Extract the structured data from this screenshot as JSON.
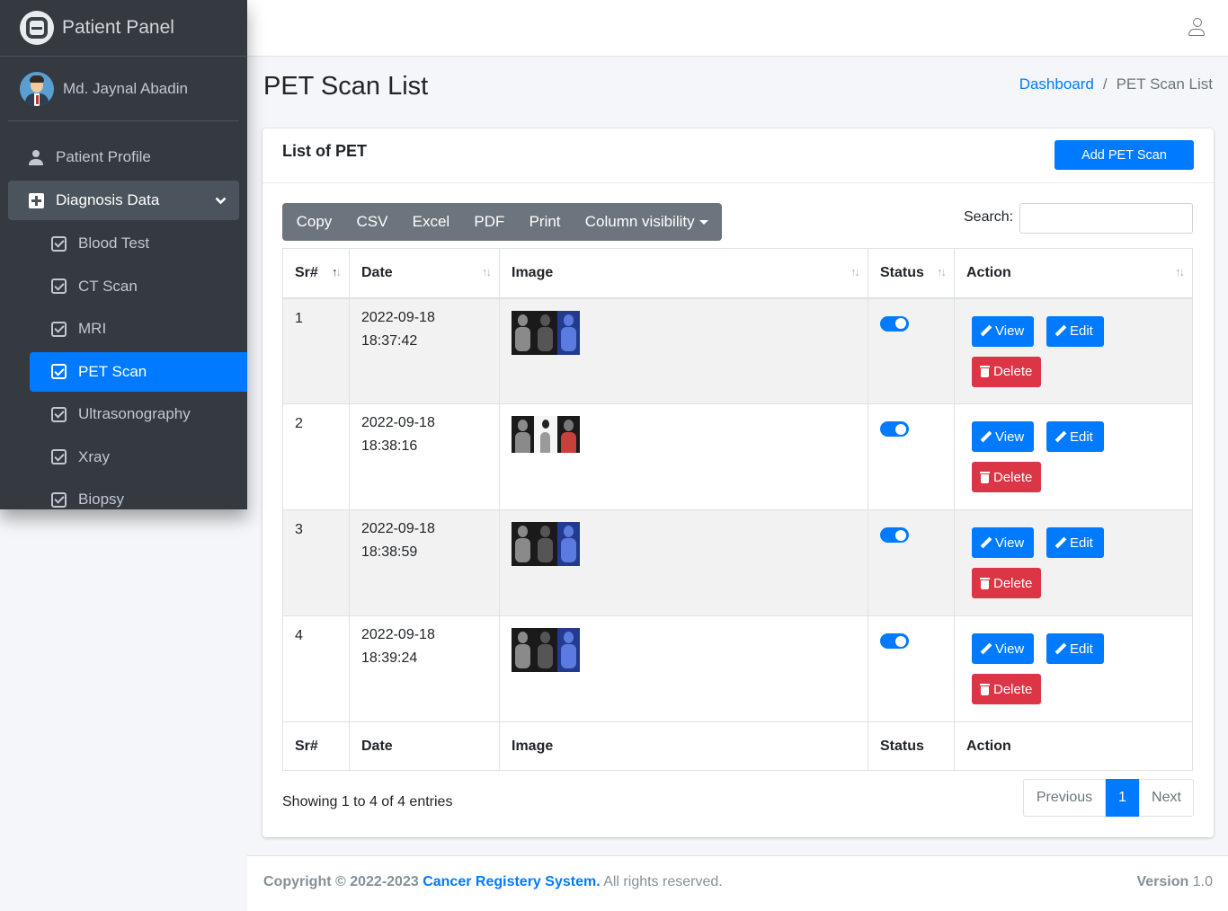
{
  "sidebar": {
    "brand": "Patient Panel",
    "user_name": "Md. Jaynal Abadin",
    "items": [
      {
        "label": "Patient Profile"
      },
      {
        "label": "Diagnosis Data"
      }
    ],
    "sub_items": [
      {
        "label": "Blood Test"
      },
      {
        "label": "CT Scan"
      },
      {
        "label": "MRI"
      },
      {
        "label": "PET Scan",
        "active": true
      },
      {
        "label": "Ultrasonography"
      },
      {
        "label": "Xray"
      },
      {
        "label": "Biopsy"
      }
    ]
  },
  "header": {
    "title": "PET Scan List",
    "breadcrumb": {
      "home": "Dashboard",
      "separator": "/",
      "current": "PET Scan List"
    }
  },
  "card": {
    "title": "List of PET",
    "add_button": "Add PET Scan",
    "export_buttons": [
      "Copy",
      "CSV",
      "Excel",
      "PDF",
      "Print",
      "Column visibility"
    ],
    "search_label": "Search:",
    "search_value": ""
  },
  "table": {
    "columns": [
      "Sr#",
      "Date",
      "Image",
      "Status",
      "Action"
    ],
    "rows": [
      {
        "sr": "1",
        "date": "2022-09-18",
        "time": "18:37:42",
        "status": true
      },
      {
        "sr": "2",
        "date": "2022-09-18",
        "time": "18:38:16",
        "status": true
      },
      {
        "sr": "3",
        "date": "2022-09-18",
        "time": "18:38:59",
        "status": true
      },
      {
        "sr": "4",
        "date": "2022-09-18",
        "time": "18:39:24",
        "status": true
      }
    ],
    "view_label": "View",
    "edit_label": "Edit",
    "delete_label": "Delete"
  },
  "pagination": {
    "info": "Showing 1 to 4 of 4 entries",
    "previous": "Previous",
    "page": "1",
    "next": "Next"
  },
  "footer": {
    "copyright_prefix": "Copyright © 2022-2023",
    "brand": "Cancer Registery System.",
    "rights": "All rights reserved.",
    "version_label": "Version",
    "version": "1.0"
  },
  "colors": {
    "primary": "#007bff",
    "danger": "#dc3545",
    "sidebar": "#343a40"
  }
}
